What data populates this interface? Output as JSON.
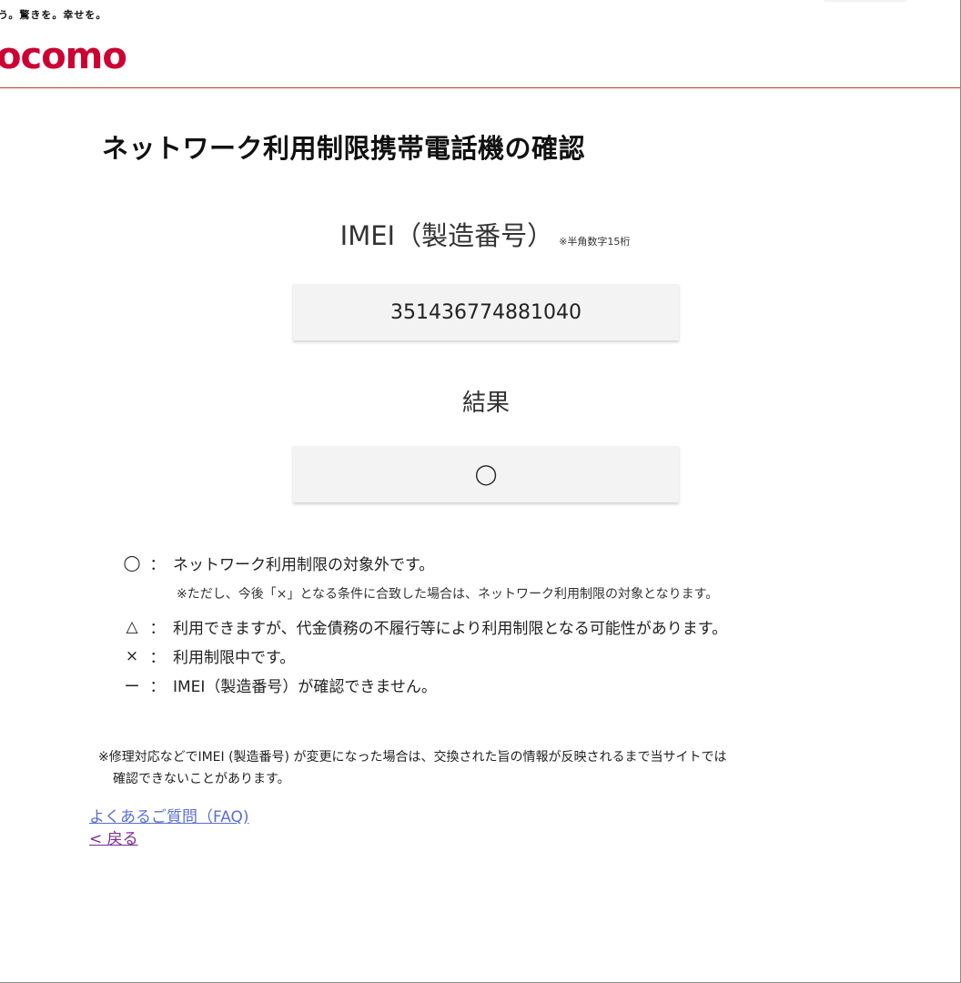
{
  "header": {
    "slogan": "う。驚きを。幸せを。",
    "logo_text": "ocomo",
    "brand_color": "#cc0033"
  },
  "page_title": "ネットワーク利用制限携帯電話機の確認",
  "imei": {
    "label": "IMEI（製造番号）",
    "note": "※半角数字15桁",
    "value": "351436774881040"
  },
  "result": {
    "label": "結果",
    "value": "◯"
  },
  "legend": [
    {
      "symbol": "◯",
      "colon": "：",
      "text": "ネットワーク利用制限の対象外です。",
      "sub": "※ただし、今後「×」となる条件に合致した場合は、ネットワーク利用制限の対象となります。"
    },
    {
      "symbol": "△",
      "colon": "：",
      "text": "利用できますが、代金債務の不履行等により利用制限となる可能性があります。"
    },
    {
      "symbol": "×",
      "colon": "：",
      "text": "利用制限中です。"
    },
    {
      "symbol": "ー",
      "colon": "：",
      "text": "IMEI（製造番号）が確認できません。"
    }
  ],
  "footnote": {
    "line1": "※修理対応などでIMEI (製造番号) が変更になった場合は、交換された旨の情報が反映されるまで当サイトでは",
    "line2": "確認できないことがあります。"
  },
  "links": {
    "faq": "よくあるご質問（FAQ)",
    "back": "< 戻る"
  }
}
